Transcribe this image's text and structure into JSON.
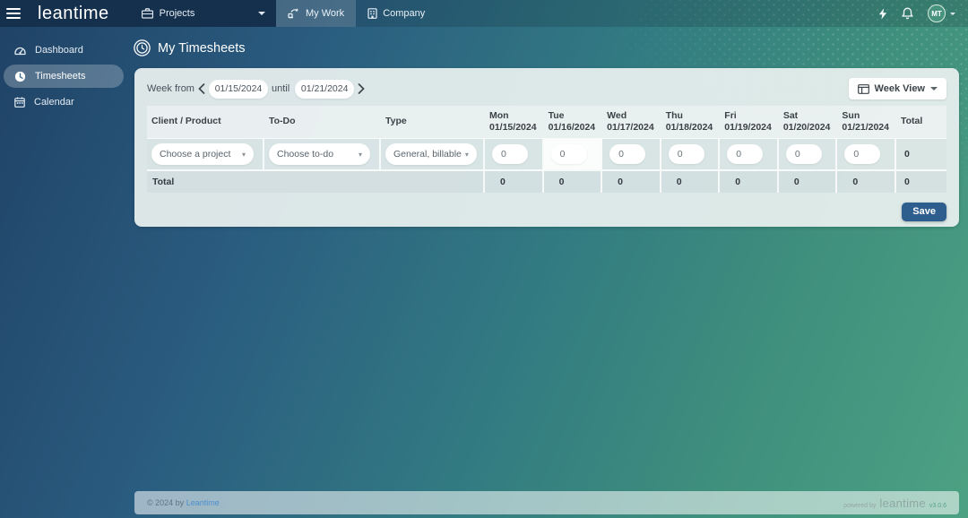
{
  "colors": {
    "gradient_start": "#1f4265",
    "gradient_end": "#4da183",
    "topbar_left_bg": "#14304c",
    "card_bg": "#e8efee",
    "save_button": "#2e5e8e",
    "link": "#4c8fce"
  },
  "topbar": {
    "logo": "leantime",
    "projects_label": "Projects",
    "tabs": [
      {
        "label": "My Work",
        "active": true
      },
      {
        "label": "Company",
        "active": false
      }
    ],
    "avatar_initials": "MT"
  },
  "sidebar": {
    "items": [
      {
        "label": "Dashboard"
      },
      {
        "label": "Timesheets"
      },
      {
        "label": "Calendar"
      }
    ]
  },
  "page": {
    "title": "My Timesheets"
  },
  "filters": {
    "week_from_label": "Week from",
    "week_start": "01/15/2024",
    "until_label": "until",
    "week_end": "01/21/2024",
    "view_button": "Week View"
  },
  "timesheet": {
    "columns": [
      "Client / Product",
      "To-Do",
      "Type"
    ],
    "total_header": "Total",
    "days": [
      {
        "name": "Mon",
        "date": "01/15/2024",
        "value": "0",
        "total": "0",
        "today": false
      },
      {
        "name": "Tue",
        "date": "01/16/2024",
        "value": "0",
        "total": "0",
        "today": true
      },
      {
        "name": "Wed",
        "date": "01/17/2024",
        "value": "0",
        "total": "0",
        "today": false
      },
      {
        "name": "Thu",
        "date": "01/18/2024",
        "value": "0",
        "total": "0",
        "today": false
      },
      {
        "name": "Fri",
        "date": "01/19/2024",
        "value": "0",
        "total": "0",
        "today": false
      },
      {
        "name": "Sat",
        "date": "01/20/2024",
        "value": "0",
        "total": "0",
        "today": false
      },
      {
        "name": "Sun",
        "date": "01/21/2024",
        "value": "0",
        "total": "0",
        "today": false
      }
    ],
    "row": {
      "project_placeholder": "Choose a project",
      "todo_placeholder": "Choose to-do",
      "type_value": "General, billable",
      "row_total": "0"
    },
    "total_row_label": "Total",
    "grand_total": "0",
    "save_label": "Save"
  },
  "footer": {
    "copyright": "© 2024 by",
    "brand_link": "Leantime",
    "powered_by": "powered by",
    "powered_brand": "leantime",
    "version": "v3.0.6"
  }
}
